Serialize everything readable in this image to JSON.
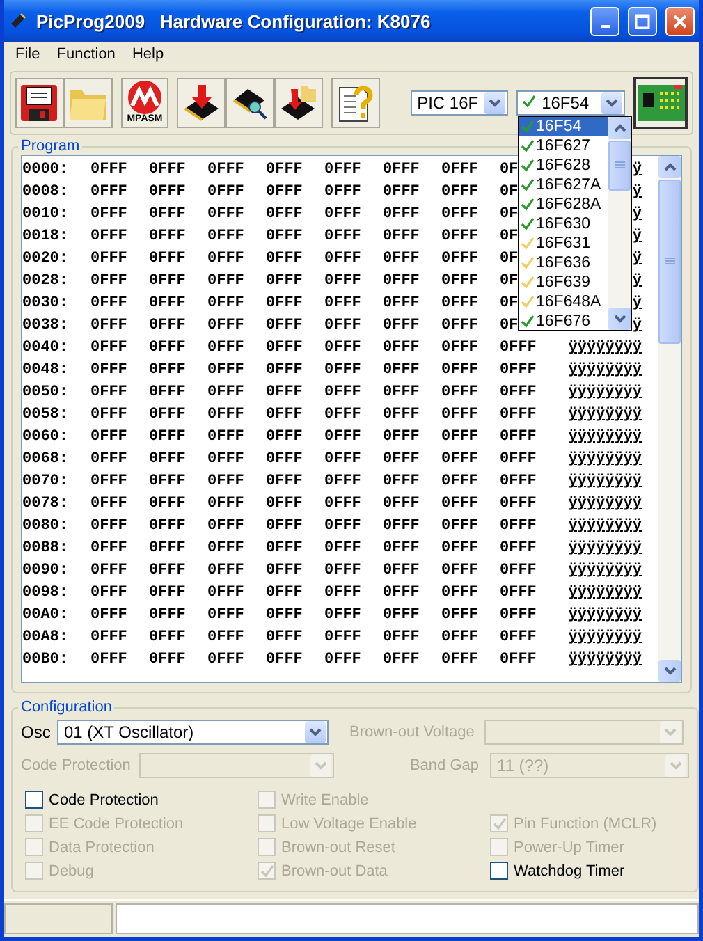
{
  "window": {
    "title": "PicProg2009   Hardware Configuration: K8076"
  },
  "menu": [
    "File",
    "Function",
    "Help"
  ],
  "toolbar": {
    "mpasm_label": "MPASM",
    "family": "PIC 16F",
    "device": "16F54"
  },
  "device_list": [
    {
      "label": "16F54",
      "selected": true,
      "color": "#2a9a2a"
    },
    {
      "label": "16F627",
      "selected": false,
      "color": "#2a9a2a"
    },
    {
      "label": "16F628",
      "selected": false,
      "color": "#2a9a2a"
    },
    {
      "label": "16F627A",
      "selected": false,
      "color": "#2a9a2a"
    },
    {
      "label": "16F628A",
      "selected": false,
      "color": "#2a9a2a"
    },
    {
      "label": "16F630",
      "selected": false,
      "color": "#2a9a2a"
    },
    {
      "label": "16F631",
      "selected": false,
      "color": "#f0d060"
    },
    {
      "label": "16F636",
      "selected": false,
      "color": "#f0d060"
    },
    {
      "label": "16F639",
      "selected": false,
      "color": "#f0d060"
    },
    {
      "label": "16F648A",
      "selected": false,
      "color": "#f0d060"
    },
    {
      "label": "16F676",
      "selected": false,
      "color": "#2a9a2a"
    }
  ],
  "program": {
    "title": "Program",
    "rows": [
      {
        "address": "0000:",
        "values": [
          "0FFF",
          "0FFF",
          "0FFF",
          "0FFF",
          "0FFF",
          "0FFF",
          "0FFF",
          "0F"
        ],
        "ascii": "ÿ"
      },
      {
        "address": "0008:",
        "values": [
          "0FFF",
          "0FFF",
          "0FFF",
          "0FFF",
          "0FFF",
          "0FFF",
          "0FFF",
          "0F"
        ],
        "ascii": "ÿ"
      },
      {
        "address": "0010:",
        "values": [
          "0FFF",
          "0FFF",
          "0FFF",
          "0FFF",
          "0FFF",
          "0FFF",
          "0FFF",
          "0F"
        ],
        "ascii": "ÿ"
      },
      {
        "address": "0018:",
        "values": [
          "0FFF",
          "0FFF",
          "0FFF",
          "0FFF",
          "0FFF",
          "0FFF",
          "0FFF",
          "0F"
        ],
        "ascii": "ÿ"
      },
      {
        "address": "0020:",
        "values": [
          "0FFF",
          "0FFF",
          "0FFF",
          "0FFF",
          "0FFF",
          "0FFF",
          "0FFF",
          "0F"
        ],
        "ascii": "ÿ"
      },
      {
        "address": "0028:",
        "values": [
          "0FFF",
          "0FFF",
          "0FFF",
          "0FFF",
          "0FFF",
          "0FFF",
          "0FFF",
          "0F"
        ],
        "ascii": "ÿ"
      },
      {
        "address": "0030:",
        "values": [
          "0FFF",
          "0FFF",
          "0FFF",
          "0FFF",
          "0FFF",
          "0FFF",
          "0FFF",
          "0F"
        ],
        "ascii": "ÿ"
      },
      {
        "address": "0038:",
        "values": [
          "0FFF",
          "0FFF",
          "0FFF",
          "0FFF",
          "0FFF",
          "0FFF",
          "0FFF",
          "0F"
        ],
        "ascii": "ÿ"
      },
      {
        "address": "0040:",
        "values": [
          "0FFF",
          "0FFF",
          "0FFF",
          "0FFF",
          "0FFF",
          "0FFF",
          "0FFF",
          "0FFF"
        ],
        "ascii": "ÿÿÿÿÿÿÿÿ"
      },
      {
        "address": "0048:",
        "values": [
          "0FFF",
          "0FFF",
          "0FFF",
          "0FFF",
          "0FFF",
          "0FFF",
          "0FFF",
          "0FFF"
        ],
        "ascii": "ÿÿÿÿÿÿÿÿ"
      },
      {
        "address": "0050:",
        "values": [
          "0FFF",
          "0FFF",
          "0FFF",
          "0FFF",
          "0FFF",
          "0FFF",
          "0FFF",
          "0FFF"
        ],
        "ascii": "ÿÿÿÿÿÿÿÿ"
      },
      {
        "address": "0058:",
        "values": [
          "0FFF",
          "0FFF",
          "0FFF",
          "0FFF",
          "0FFF",
          "0FFF",
          "0FFF",
          "0FFF"
        ],
        "ascii": "ÿÿÿÿÿÿÿÿ"
      },
      {
        "address": "0060:",
        "values": [
          "0FFF",
          "0FFF",
          "0FFF",
          "0FFF",
          "0FFF",
          "0FFF",
          "0FFF",
          "0FFF"
        ],
        "ascii": "ÿÿÿÿÿÿÿÿ"
      },
      {
        "address": "0068:",
        "values": [
          "0FFF",
          "0FFF",
          "0FFF",
          "0FFF",
          "0FFF",
          "0FFF",
          "0FFF",
          "0FFF"
        ],
        "ascii": "ÿÿÿÿÿÿÿÿ"
      },
      {
        "address": "0070:",
        "values": [
          "0FFF",
          "0FFF",
          "0FFF",
          "0FFF",
          "0FFF",
          "0FFF",
          "0FFF",
          "0FFF"
        ],
        "ascii": "ÿÿÿÿÿÿÿÿ"
      },
      {
        "address": "0078:",
        "values": [
          "0FFF",
          "0FFF",
          "0FFF",
          "0FFF",
          "0FFF",
          "0FFF",
          "0FFF",
          "0FFF"
        ],
        "ascii": "ÿÿÿÿÿÿÿÿ"
      },
      {
        "address": "0080:",
        "values": [
          "0FFF",
          "0FFF",
          "0FFF",
          "0FFF",
          "0FFF",
          "0FFF",
          "0FFF",
          "0FFF"
        ],
        "ascii": "ÿÿÿÿÿÿÿÿ"
      },
      {
        "address": "0088:",
        "values": [
          "0FFF",
          "0FFF",
          "0FFF",
          "0FFF",
          "0FFF",
          "0FFF",
          "0FFF",
          "0FFF"
        ],
        "ascii": "ÿÿÿÿÿÿÿÿ"
      },
      {
        "address": "0090:",
        "values": [
          "0FFF",
          "0FFF",
          "0FFF",
          "0FFF",
          "0FFF",
          "0FFF",
          "0FFF",
          "0FFF"
        ],
        "ascii": "ÿÿÿÿÿÿÿÿ"
      },
      {
        "address": "0098:",
        "values": [
          "0FFF",
          "0FFF",
          "0FFF",
          "0FFF",
          "0FFF",
          "0FFF",
          "0FFF",
          "0FFF"
        ],
        "ascii": "ÿÿÿÿÿÿÿÿ"
      },
      {
        "address": "00A0:",
        "values": [
          "0FFF",
          "0FFF",
          "0FFF",
          "0FFF",
          "0FFF",
          "0FFF",
          "0FFF",
          "0FFF"
        ],
        "ascii": "ÿÿÿÿÿÿÿÿ"
      },
      {
        "address": "00A8:",
        "values": [
          "0FFF",
          "0FFF",
          "0FFF",
          "0FFF",
          "0FFF",
          "0FFF",
          "0FFF",
          "0FFF"
        ],
        "ascii": "ÿÿÿÿÿÿÿÿ"
      },
      {
        "address": "00B0:",
        "values": [
          "0FFF",
          "0FFF",
          "0FFF",
          "0FFF",
          "0FFF",
          "0FFF",
          "0FFF",
          "0FFF"
        ],
        "ascii": "ÿÿÿÿÿÿÿÿ"
      }
    ]
  },
  "configuration": {
    "title": "Configuration",
    "osc": {
      "label": "Osc",
      "value": "01 (XT Oscillator)",
      "disabled": false
    },
    "brownout_voltage": {
      "label": "Brown-out Voltage",
      "disabled": true
    },
    "code_protection": {
      "label": "Code Protection",
      "disabled": true
    },
    "band_gap": {
      "label": "Band Gap",
      "value": "11 (??)",
      "disabled": true
    },
    "checkbox_columns": [
      [
        {
          "label": "Code Protection",
          "checked": false,
          "disabled": false
        },
        {
          "label": "EE Code Protection",
          "checked": false,
          "disabled": true
        },
        {
          "label": "Data Protection",
          "checked": false,
          "disabled": true
        },
        {
          "label": "Debug",
          "checked": false,
          "disabled": true
        }
      ],
      [
        {
          "label": "Write Enable",
          "checked": false,
          "disabled": true
        },
        {
          "label": "Low Voltage Enable",
          "checked": false,
          "disabled": true
        },
        {
          "label": "Brown-out Reset",
          "checked": false,
          "disabled": true
        },
        {
          "label": "Brown-out Data",
          "checked": true,
          "disabled": true
        }
      ],
      [
        {
          "label": "Pin Function (MCLR)",
          "checked": true,
          "disabled": true
        },
        {
          "label": "Power-Up Timer",
          "checked": false,
          "disabled": true
        },
        {
          "label": "Watchdog Timer",
          "checked": false,
          "disabled": false
        }
      ]
    ]
  }
}
